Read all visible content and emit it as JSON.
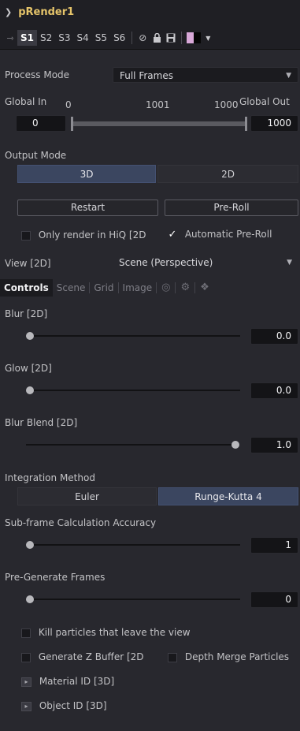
{
  "tool": {
    "name": "pRender1",
    "expand_icon": "chevron-down"
  },
  "settings_bar": {
    "slots": [
      "S1",
      "S2",
      "S3",
      "S4",
      "S5",
      "S6"
    ],
    "active_slot": "S1",
    "icons": [
      "pin-icon",
      "disable-icon",
      "lock-icon",
      "save-icon",
      "color-swatch-icon",
      "dropdown-arrow-icon"
    ],
    "swatch_colors": [
      "#d8a8d8",
      "#050505"
    ]
  },
  "process_mode": {
    "label": "Process Mode",
    "value": "Full Frames"
  },
  "global": {
    "in_label": "Global In",
    "out_label": "Global Out",
    "in_value_top": "0",
    "mid_value": "1001",
    "out_value_top": "1000",
    "in_field": "0",
    "out_field": "1000"
  },
  "output_mode": {
    "label": "Output Mode",
    "options": [
      "3D",
      "2D"
    ],
    "selected": "3D"
  },
  "buttons": {
    "restart": "Restart",
    "preroll": "Pre-Roll"
  },
  "checks": {
    "only_render_hiq": {
      "label": "Only render in HiQ [2D",
      "checked": false
    },
    "automatic_preroll": {
      "label": "Automatic Pre-Roll",
      "checked": true
    }
  },
  "view": {
    "label": "View [2D]",
    "value": "Scene (Perspective)"
  },
  "tabs": [
    "Controls",
    "Scene",
    "Grid",
    "Image"
  ],
  "active_tab": "Controls",
  "tab_icons": [
    "motion-blur-icon",
    "settings-gear-icon",
    "info-icon"
  ],
  "blur": {
    "label": "Blur [2D]",
    "value": "0.0",
    "fraction": 0.0
  },
  "glow": {
    "label": "Glow [2D]",
    "value": "0.0",
    "fraction": 0.0
  },
  "blur_blend": {
    "label": "Blur Blend [2D]",
    "value": "1.0",
    "fraction": 1.0
  },
  "integration": {
    "label": "Integration Method",
    "options": [
      "Euler",
      "Runge-Kutta 4"
    ],
    "selected": "Runge-Kutta 4"
  },
  "subframe": {
    "label": "Sub-frame Calculation Accuracy",
    "value": "1",
    "fraction": 0.0
  },
  "pregen": {
    "label": "Pre-Generate Frames",
    "value": "0",
    "fraction": 0.0
  },
  "bottom_checks": {
    "kill_particles": {
      "label": "Kill particles that leave the view",
      "checked": false
    },
    "gen_z": {
      "label": "Generate Z Buffer [2D",
      "checked": false
    },
    "depth_merge": {
      "label": "Depth Merge Particles",
      "checked": false
    }
  },
  "material_id": {
    "label": "Material ID [3D]"
  },
  "object_id": {
    "label": "Object ID [3D]"
  }
}
